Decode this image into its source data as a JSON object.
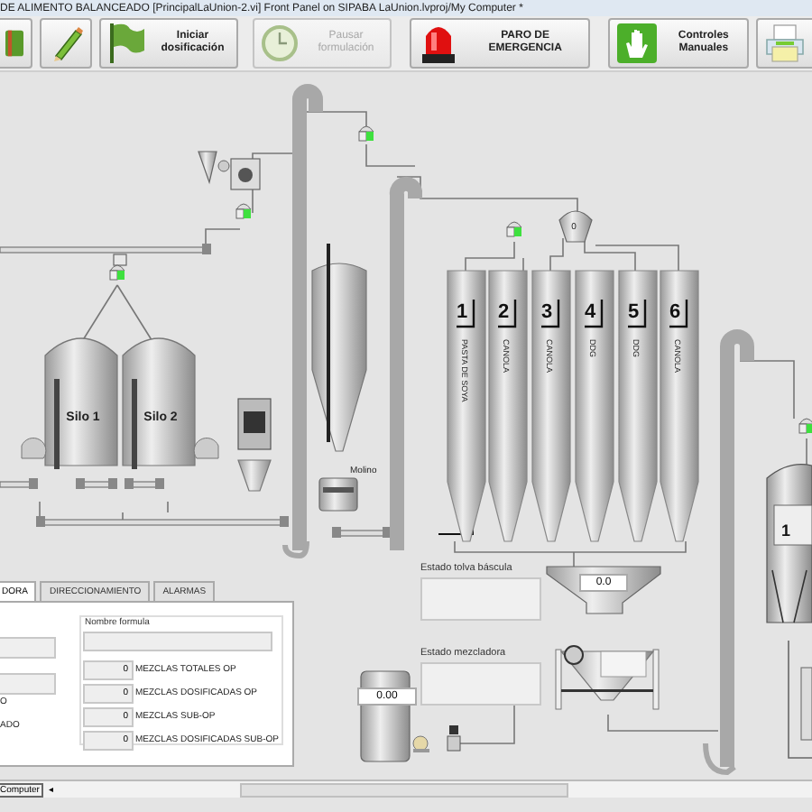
{
  "window": {
    "title": "DE ALIMENTO BALANCEADO [PrincipalLaUnion-2.vi] Front Panel on SIPABA LaUnion.lvproj/My Computer *"
  },
  "toolbar": [
    {
      "kind": "book"
    },
    {
      "kind": "pencil"
    },
    {
      "kind": "flag",
      "label": "Iniciar dosificación",
      "disabled": false
    },
    {
      "kind": "clock",
      "label": "Pausar formulación",
      "disabled": true
    },
    {
      "kind": "beacon",
      "label": "PARO DE EMERGENCIA",
      "disabled": false
    },
    {
      "kind": "hand",
      "label": "Controles Manuales",
      "disabled": false
    },
    {
      "kind": "printer"
    }
  ],
  "plant": {
    "silos": [
      "Silo 1",
      "Silo 2"
    ],
    "mill_label": "Molino",
    "scale_reading": "0",
    "bins": [
      {
        "number": "1",
        "material": "PASTA DE SOYA"
      },
      {
        "number": "2",
        "material": "CANOLA"
      },
      {
        "number": "3",
        "material": "CANOLA"
      },
      {
        "number": "4",
        "material": "DDG"
      },
      {
        "number": "5",
        "material": "DDG"
      },
      {
        "number": "6",
        "material": "CANOLA"
      }
    ],
    "sensors": [
      {
        "on": true
      },
      {
        "on": true
      },
      {
        "on": true
      },
      {
        "on": true
      },
      {
        "on": true
      }
    ],
    "hopper_reading": "0.0",
    "tank_reading": "0.00",
    "right_tank_number": "1",
    "hopper_status_label": "Estado tolva báscula",
    "mixer_status_label": "Estado mezcladora"
  },
  "tabs": [
    {
      "label": "DORA",
      "selected": true
    },
    {
      "label": "DIRECCIONAMIENTO",
      "selected": false
    },
    {
      "label": "ALARMAS",
      "selected": false
    }
  ],
  "panel": {
    "left_texts": [
      "O",
      "ADO"
    ],
    "formula_label": "Nombre formula",
    "counters": [
      {
        "value": "0",
        "label": "MEZCLAS TOTALES OP"
      },
      {
        "value": "0",
        "label": "MEZCLAS DOSIFICADAS OP"
      },
      {
        "value": "0",
        "label": "MEZCLAS SUB-OP"
      },
      {
        "value": "0",
        "label": "MEZCLAS DOSIFICADAS SUB-OP"
      }
    ]
  },
  "status_bar": {
    "tab": "Computer",
    "arrow": "◂"
  }
}
